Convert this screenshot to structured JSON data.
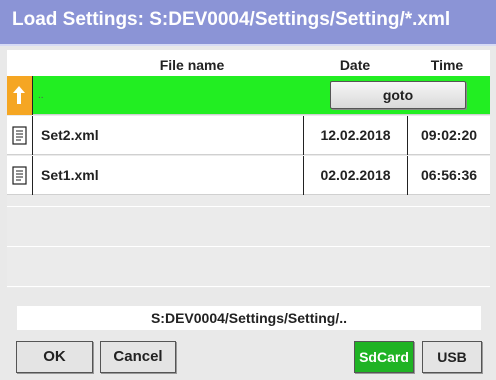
{
  "title": "Load Settings:  S:DEV0004/Settings/Setting/*.xml",
  "columns": {
    "file_name": "File name",
    "date": "Date",
    "time": "Time"
  },
  "up_row": {
    "name": "..",
    "button": "goto"
  },
  "files": [
    {
      "name": "Set2.xml",
      "date": "12.02.2018",
      "time": "09:02:20"
    },
    {
      "name": "Set1.xml",
      "date": "02.02.2018",
      "time": "06:56:36"
    }
  ],
  "path": "S:DEV0004/Settings/Setting/..",
  "buttons": {
    "ok": "OK",
    "cancel": "Cancel",
    "sdcard": "SdCard",
    "usb": "USB"
  },
  "colors": {
    "title_bg": "#8b94d6",
    "selected_row": "#22ee22",
    "active_storage": "#1fb324",
    "up_arrow": "#f5a623"
  },
  "icons": {
    "up": "folder-up-arrow-icon",
    "file": "document-icon"
  }
}
